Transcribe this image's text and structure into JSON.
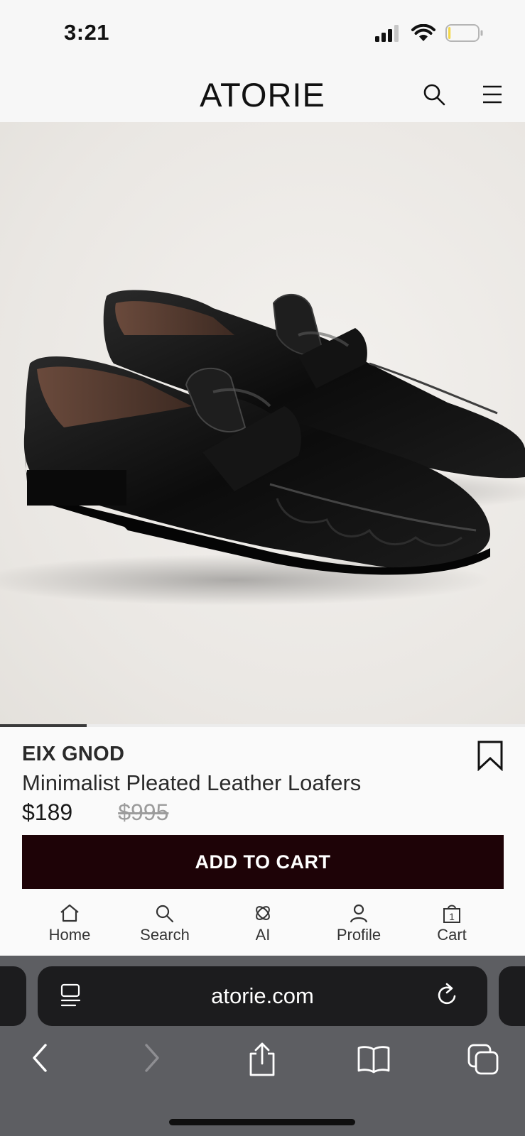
{
  "status_bar": {
    "time": "3:21"
  },
  "header": {
    "brand": "ATORIE"
  },
  "product": {
    "brand": "EIX GNOD",
    "name": "Minimalist Pleated Leather Loafers",
    "price": "$189",
    "original_price": "$995",
    "add_to_cart_label": "ADD TO CART",
    "gallery_progress": 0.165
  },
  "nav": {
    "items": [
      {
        "label": "Home",
        "icon": "home-icon"
      },
      {
        "label": "Search",
        "icon": "search-icon"
      },
      {
        "label": "AI",
        "icon": "ai-icon"
      },
      {
        "label": "Profile",
        "icon": "profile-icon"
      },
      {
        "label": "Cart",
        "icon": "cart-icon",
        "badge": "1"
      }
    ]
  },
  "browser": {
    "url": "atorie.com"
  },
  "colors": {
    "cart_button": "#1e0307",
    "page_bg": "#fafafa",
    "browser_chrome": "#5d5e62",
    "url_bar": "#1c1c1e",
    "battery_level": "#f4d84a"
  },
  "battery_level": 0.08
}
